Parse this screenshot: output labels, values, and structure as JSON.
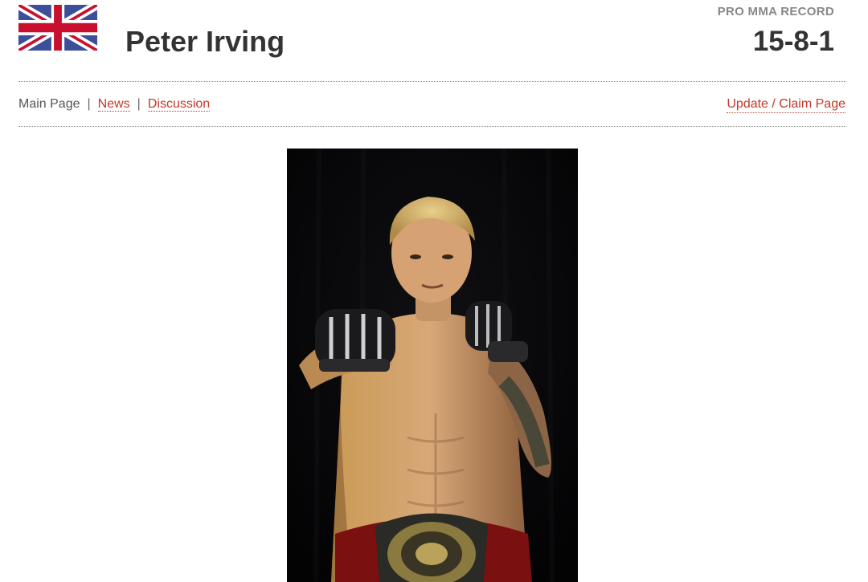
{
  "header": {
    "flag_icon": "uk-flag-icon",
    "fighter_name": "Peter Irving",
    "record_label": "PRO MMA RECORD",
    "record_value": "15-8-1"
  },
  "nav": {
    "main_page": "Main Page",
    "news": "News",
    "discussion": "Discussion",
    "separator": "|",
    "update_claim": "Update / Claim Page"
  },
  "colors": {
    "link": "#c0392b",
    "heading": "#333333",
    "muted": "#888888"
  }
}
